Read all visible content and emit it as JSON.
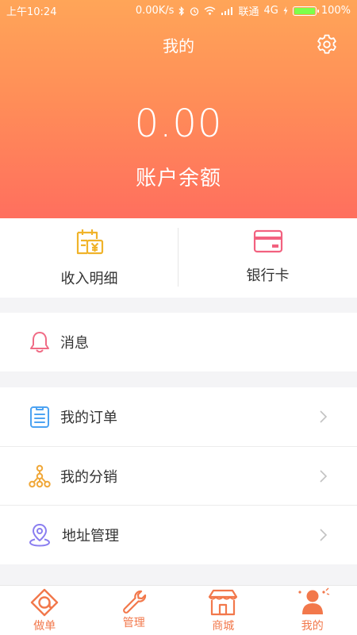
{
  "status_bar": {
    "time": "上午10:24",
    "speed": "0.00K/s",
    "carrier": "联通",
    "network": "4G",
    "battery": "100%",
    "battery_level": 1.0
  },
  "header": {
    "title": "我的",
    "balance": "0.00",
    "balance_label": "账户余额"
  },
  "quick_actions": [
    {
      "label": "收入明细",
      "icon": "income-detail-icon"
    },
    {
      "label": "银行卡",
      "icon": "bank-card-icon"
    }
  ],
  "menu": {
    "message": "消息",
    "orders": "我的订单",
    "distribution": "我的分销",
    "address": "地址管理"
  },
  "tabs": [
    {
      "label": "做单",
      "icon": "order-tab-icon"
    },
    {
      "label": "管理",
      "icon": "wrench-icon"
    },
    {
      "label": "商城",
      "icon": "shop-icon"
    },
    {
      "label": "我的",
      "icon": "profile-icon"
    }
  ],
  "colors": {
    "header_top": "#ffa558",
    "header_bottom": "#ff6f5e",
    "accent": "#f2784b",
    "income_icon": "#f0b32a",
    "bank_icon": "#f2617f",
    "bell_icon": "#f06b85",
    "orders_icon": "#4da3f2",
    "distribution_icon": "#f0a83a",
    "address_icon": "#8a7ef0"
  }
}
